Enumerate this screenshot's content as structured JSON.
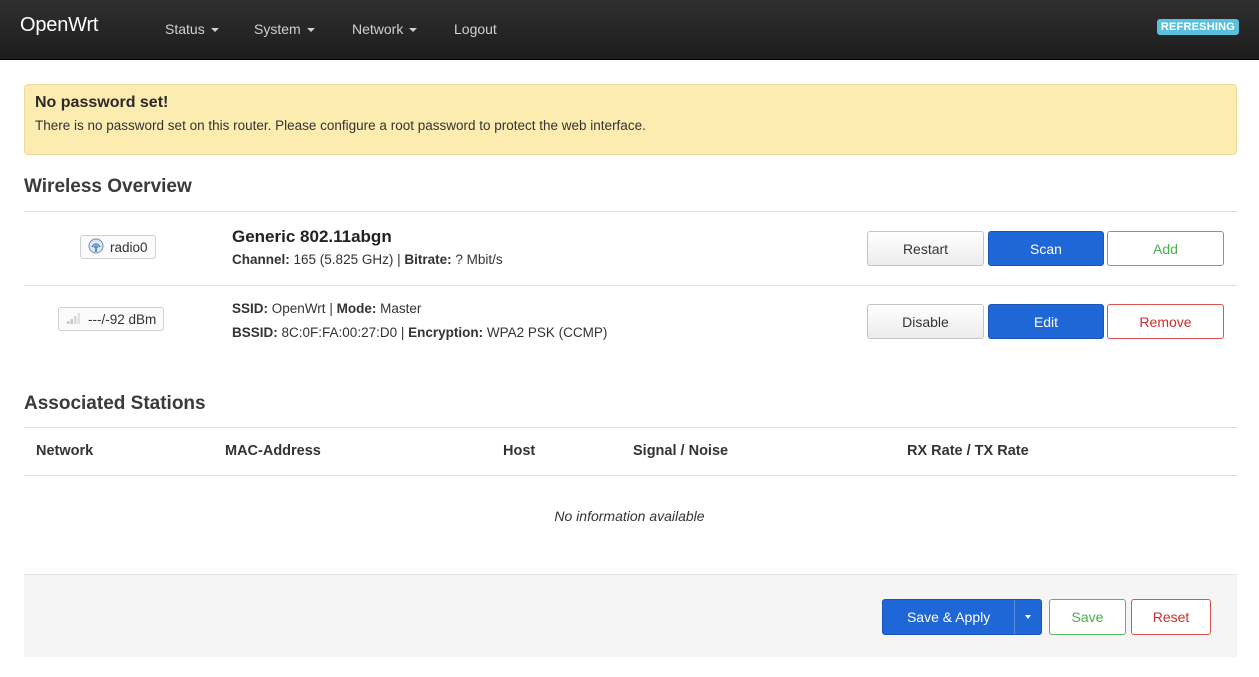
{
  "navbar": {
    "brand": "OpenWrt",
    "menu": [
      {
        "label": "Status",
        "has_caret": true
      },
      {
        "label": "System",
        "has_caret": true
      },
      {
        "label": "Network",
        "has_caret": true
      },
      {
        "label": "Logout",
        "has_caret": false
      }
    ],
    "status_badge": "REFRESHING",
    "badge_color": "#5bc0de"
  },
  "alert": {
    "title": "No password set!",
    "message": "There is no password set on this router. Please configure a root password to protect the web interface."
  },
  "wireless": {
    "heading": "Wireless Overview",
    "radio": {
      "badge": "radio0",
      "badge_icon": "wireless-radio-icon",
      "title": "Generic 802.11abgn",
      "channel_label": "Channel:",
      "channel_value": "165 (5.825 GHz)",
      "bitrate_label": "Bitrate:",
      "bitrate_value": "? Mbit/s",
      "buttons": {
        "restart": "Restart",
        "scan": "Scan",
        "add": "Add"
      }
    },
    "network": {
      "badge": "---/-92 dBm",
      "badge_icon": "signal-strength-icon",
      "ssid_label": "SSID:",
      "ssid_value": "OpenWrt",
      "mode_label": "Mode:",
      "mode_value": "Master",
      "bssid_label": "BSSID:",
      "bssid_value": "8C:0F:FA:00:27:D0",
      "encryption_label": "Encryption:",
      "encryption_value": "WPA2 PSK (CCMP)",
      "buttons": {
        "disable": "Disable",
        "edit": "Edit",
        "remove": "Remove"
      }
    }
  },
  "stations": {
    "heading": "Associated Stations",
    "columns": [
      "Network",
      "MAC-Address",
      "Host",
      "Signal / Noise",
      "RX Rate / TX Rate"
    ],
    "empty_text": "No information available"
  },
  "footer": {
    "save_apply": "Save & Apply",
    "save": "Save",
    "reset": "Reset"
  },
  "colors": {
    "primary": "#1f66d6",
    "success": "#5cb85c",
    "danger": "#d9534f",
    "alert_bg": "#fcecb0"
  }
}
